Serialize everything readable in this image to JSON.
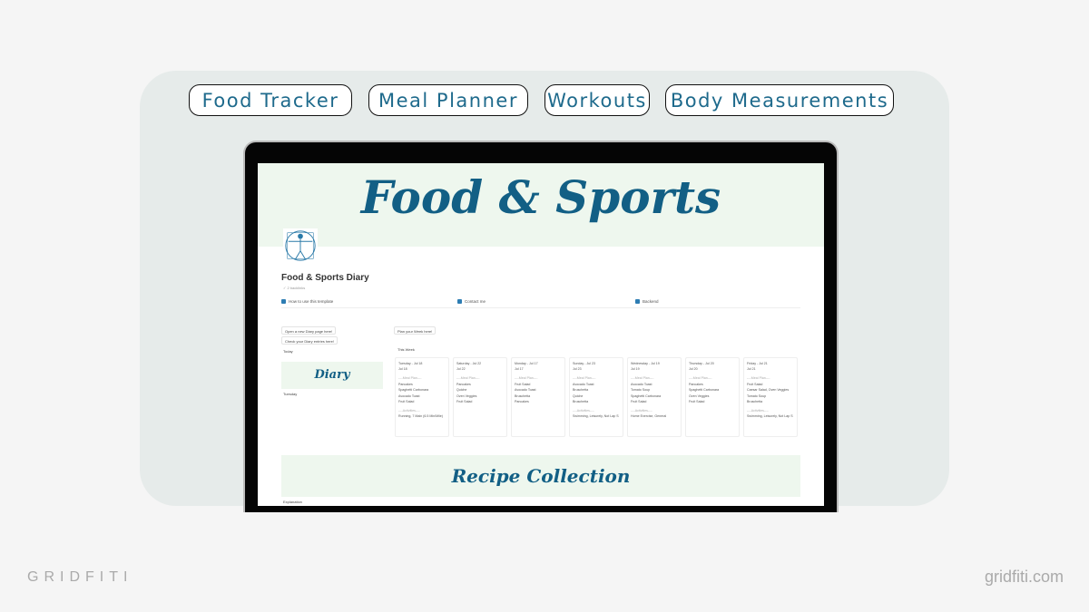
{
  "tags": [
    "Food Tracker",
    "Meal Planner",
    "Workouts",
    "Body Measurements"
  ],
  "cover_title": "Food & Sports",
  "page": {
    "title": "Food & Sports Diary",
    "subtitle": "✓ 2 backlinks",
    "links": [
      "How to use this template",
      "Contact me",
      "Backend"
    ]
  },
  "left": {
    "buttons": [
      "Open a new Diary page here!",
      "Check your Diary entries here!"
    ],
    "tab": "Today",
    "gallery_title": "Diary",
    "entry": "Tuesday"
  },
  "right": {
    "button": "Plan your Week here!",
    "tab": "This Week",
    "meal_sep": "----Meal Plan----",
    "work_sep": "----Activities----",
    "cards": [
      {
        "title": "Tuesday - Jul 18",
        "date": "Jul 18",
        "meals": [
          "Pancakes",
          "Spaghetti Carbonara",
          "Avocado Toast",
          "Fruit Salad"
        ],
        "activity": "Running, 7 Main (6.5 Min/Mile)"
      },
      {
        "title": "Saturday - Jul 22",
        "date": "Jul 22",
        "meals": [
          "Pancakes",
          "Quiche",
          "Oven Veggies",
          "Fruit Salad"
        ],
        "activity": ""
      },
      {
        "title": "Monday - Jul 17",
        "date": "Jul 17",
        "meals": [
          "Fruit Salad",
          "Avocado Toast",
          "Bruschetta",
          "Pancakes"
        ],
        "activity": ""
      },
      {
        "title": "Sunday - Jul 23",
        "date": "Jul 23",
        "meals": [
          "Avocado Toast",
          "Bruschetta",
          "Quiche",
          "Bruschetta"
        ],
        "activity": "Swimming, Leisurely, Not Lap S"
      },
      {
        "title": "Wednesday - Jul 19",
        "date": "Jul 19",
        "meals": [
          "Avocado Toast",
          "Tomato Soup",
          "Spaghetti Carbonara",
          "Fruit Salad"
        ],
        "activity": "Home Exercise, General"
      },
      {
        "title": "Thursday - Jul 20",
        "date": "Jul 20",
        "meals": [
          "Pancakes",
          "Spaghetti Carbonara",
          "Oven Veggies",
          "Fruit Salad"
        ],
        "activity": ""
      },
      {
        "title": "Friday - Jul 21",
        "date": "Jul 21",
        "meals": [
          "Fruit Salad",
          "Caesar Salad, Oven Veggies",
          "Tomato Soup",
          "Bruschetta"
        ],
        "activity": "Swimming, Leisurely, Not Lap S"
      }
    ]
  },
  "recipe_title": "Recipe Collection",
  "toggle": "Explanation",
  "footer": {
    "left": "GRIDFITI",
    "right": "gridfiti.com"
  }
}
